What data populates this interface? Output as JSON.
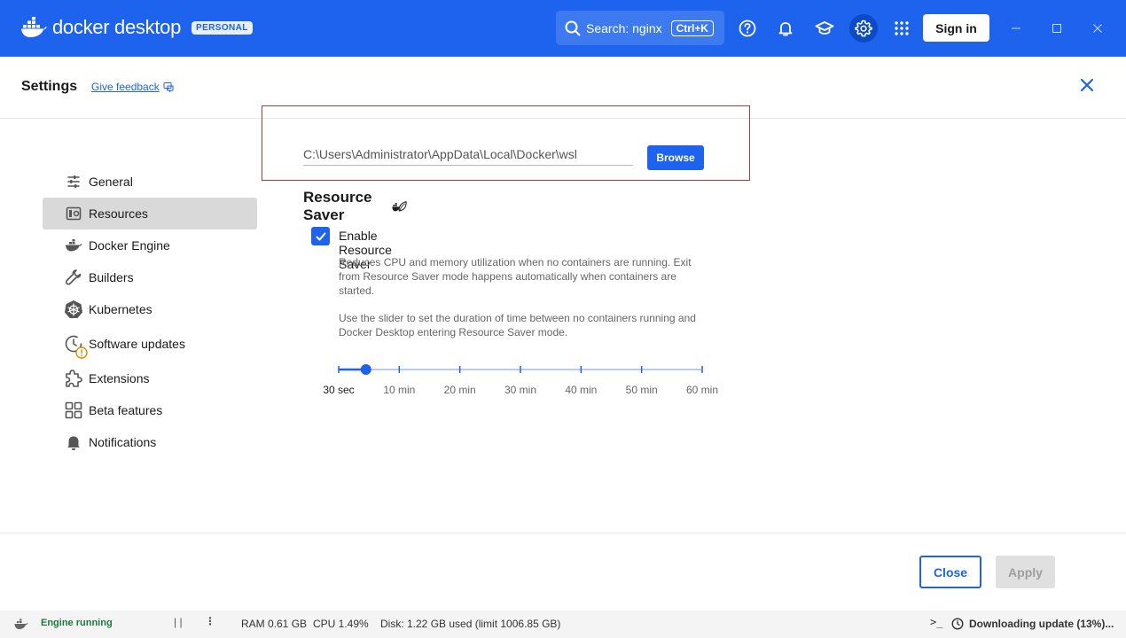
{
  "app": {
    "logo_text": "docker desktop",
    "badge": "PERSONAL",
    "search_label": "Search: nginx",
    "search_shortcut": "Ctrl+K",
    "signin_label": "Sign in"
  },
  "header": {
    "title": "Settings",
    "feedback_label": "Give feedback"
  },
  "sidebar": {
    "items": [
      {
        "label": "General",
        "icon": "sliders-icon"
      },
      {
        "label": "Resources",
        "icon": "resources-icon",
        "active": true
      },
      {
        "label": "Docker Engine",
        "icon": "engine-icon"
      },
      {
        "label": "Builders",
        "icon": "wrench-icon"
      },
      {
        "label": "Kubernetes",
        "icon": "kubernetes-icon"
      },
      {
        "label": "Software updates",
        "icon": "clock-icon",
        "warning": true
      },
      {
        "label": "Extensions",
        "icon": "puzzle-icon"
      },
      {
        "label": "Beta features",
        "icon": "grid-icon"
      },
      {
        "label": "Notifications",
        "icon": "bell-icon"
      }
    ]
  },
  "content": {
    "disk_image_path": "C:\\Users\\Administrator\\AppData\\Local\\Docker\\wsl",
    "browse_label": "Browse",
    "resource_saver_title": "Resource Saver",
    "enable_label": "Enable Resource Saver",
    "enable_checked": true,
    "desc1": "Reduces CPU and memory utilization when no containers are running. Exit from Resource Saver mode happens automatically when containers are started.",
    "desc2": "Use the slider to set the duration of time between no containers running and Docker Desktop entering Resource Saver mode.",
    "slider": {
      "ticks": [
        "30 sec",
        "10 min",
        "20 min",
        "30 min",
        "40 min",
        "50 min",
        "60 min"
      ],
      "value_fraction": 0.075
    }
  },
  "footer": {
    "close_label": "Close",
    "apply_label": "Apply"
  },
  "status": {
    "engine": "Engine running",
    "ram": "RAM 0.61 GB",
    "cpu": "CPU 1.49%",
    "disk": "Disk: 1.22 GB used (limit 1006.85 GB)",
    "update": "Downloading update (13%)..."
  },
  "colors": {
    "brand": "#1d63ed",
    "highlight_box": "#d32f2f",
    "engine_ok": "#1b7a3b"
  }
}
